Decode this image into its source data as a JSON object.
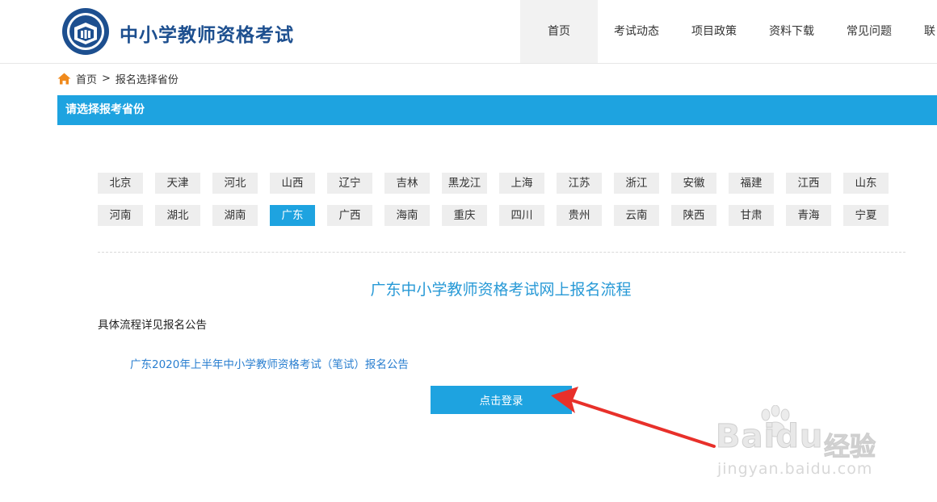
{
  "header": {
    "site_title": "中小学教师资格考试",
    "nav": [
      {
        "label": "首页",
        "active": true
      },
      {
        "label": "考试动态",
        "active": false
      },
      {
        "label": "项目政策",
        "active": false
      },
      {
        "label": "资料下载",
        "active": false
      },
      {
        "label": "常见问题",
        "active": false
      },
      {
        "label": "联",
        "active": false
      }
    ]
  },
  "breadcrumb": {
    "home": "首页",
    "separator": ">",
    "current": "报名选择省份"
  },
  "province_bar": {
    "title": "请选择报考省份"
  },
  "provinces": {
    "row1": [
      "北京",
      "天津",
      "河北",
      "山西",
      "辽宁",
      "吉林",
      "黑龙江",
      "上海",
      "江苏",
      "浙江",
      "安徽",
      "福建",
      "江西",
      "山东"
    ],
    "row2": [
      "河南",
      "湖北",
      "湖南",
      "广东",
      "广西",
      "海南",
      "重庆",
      "四川",
      "贵州",
      "云南",
      "陕西",
      "甘肃",
      "青海",
      "宁夏"
    ],
    "selected": "广东"
  },
  "process": {
    "title": "广东中小学教师资格考试网上报名流程",
    "detail_note": "具体流程详见报名公告",
    "notice_link": "广东2020年上半年中小学教师资格考试（笔试）报名公告",
    "login_button": "点击登录"
  },
  "watermark": {
    "brand": "Baidu",
    "cn": "经验",
    "url": "jingyan.baidu.com"
  },
  "colors": {
    "accent": "#1ea3e0",
    "title_blue": "#1d4f8f",
    "link_blue": "#2a7fd0",
    "arrow_red": "#e8302a"
  },
  "icons": {
    "home": "home-icon",
    "logo": "teacher-exam-logo"
  }
}
